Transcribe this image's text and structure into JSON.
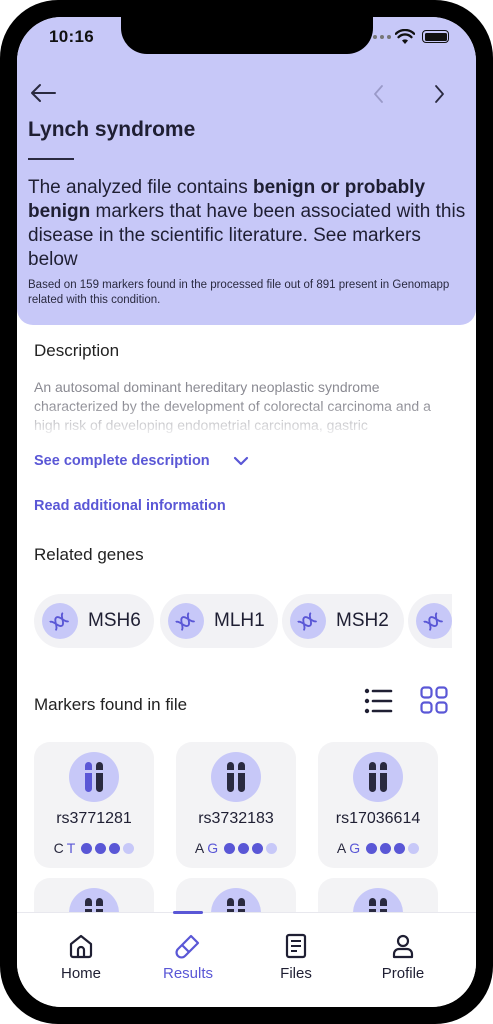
{
  "status": {
    "time": "10:16"
  },
  "colors": {
    "accent": "#5a57d6",
    "header_bg": "#c7c8f8",
    "dot_inactive": "#c7c8f8"
  },
  "header": {
    "title": "Lynch syndrome",
    "headline_1": "The analyzed file contains ",
    "headline_bold": "benign or probably benign",
    "headline_2": " markers that have been associated with this disease in the scientific literature. See markers below",
    "subtext": "Based on 159 markers found in the processed file out of 891 present in Genomapp related with this condition."
  },
  "description": {
    "title": "Description",
    "text": "An autosomal dominant hereditary neoplastic syndrome characterized by the development of colorectal carcinoma and a high risk of developing endometrial carcinoma, gastric",
    "see_complete_label": "See complete description",
    "read_additional_label": "Read additional information"
  },
  "related_genes": {
    "title": "Related genes",
    "items": [
      {
        "label": "MSH6",
        "icon": "dna-icon"
      },
      {
        "label": "MLH1",
        "icon": "dna-icon"
      },
      {
        "label": "MSH2",
        "icon": "dna-icon"
      },
      {
        "label": "",
        "icon": "dna-icon"
      }
    ]
  },
  "markers": {
    "title": "Markers found in file",
    "items": [
      {
        "rs": "rs3771281",
        "allele1": "C",
        "allele2": "T",
        "level": 3,
        "max": 4
      },
      {
        "rs": "rs3732183",
        "allele1": "A",
        "allele2": "G",
        "level": 3,
        "max": 4
      },
      {
        "rs": "rs17036614",
        "allele1": "A",
        "allele2": "G",
        "level": 3,
        "max": 4
      },
      {
        "rs": "",
        "allele1": "",
        "allele2": "",
        "level": 0,
        "max": 0
      },
      {
        "rs": "",
        "allele1": "",
        "allele2": "",
        "level": 0,
        "max": 0
      },
      {
        "rs": "",
        "allele1": "",
        "allele2": "",
        "level": 0,
        "max": 0
      }
    ]
  },
  "tabs": [
    {
      "label": "Home",
      "icon": "home-icon",
      "active": false
    },
    {
      "label": "Results",
      "icon": "test-tube-icon",
      "active": true
    },
    {
      "label": "Files",
      "icon": "file-icon",
      "active": false
    },
    {
      "label": "Profile",
      "icon": "user-icon",
      "active": false
    }
  ]
}
